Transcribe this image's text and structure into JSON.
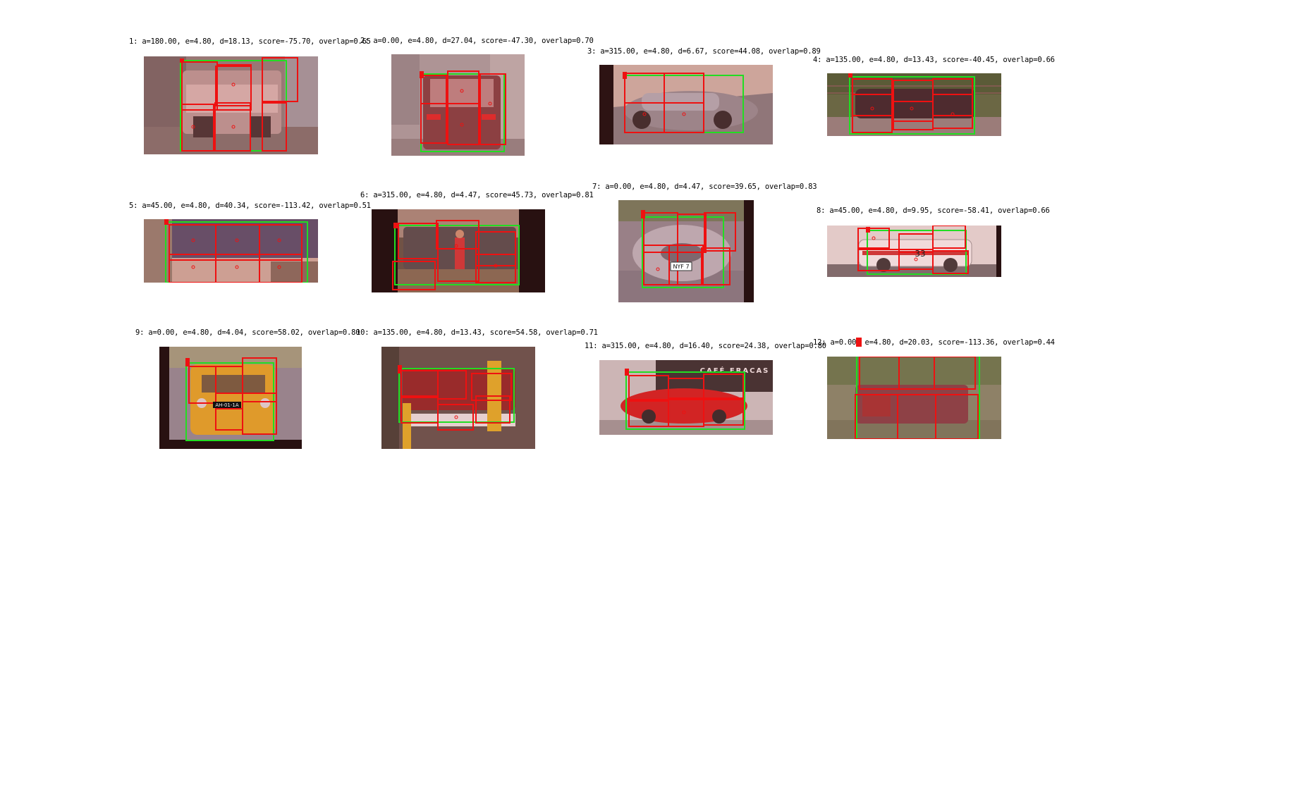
{
  "figure": {
    "background": "#ffffff",
    "colors": {
      "ground_truth_box": "#22dd22",
      "part_box": "#ee1111",
      "tint": "#e06060"
    },
    "panels": [
      {
        "id": 1,
        "caption": "1: a=180.00, e=4.80, d=18.13, score=-75.70, overlap=0.65",
        "scene": "car rear view at bus stop"
      },
      {
        "id": 2,
        "caption": "2: a=0.00, e=4.80, d=27.04, score=-47.30, overlap=0.70",
        "scene": "car rear view on street"
      },
      {
        "id": 3,
        "caption": "3: a=315.00, e=4.80, d=6.67, score=44.08, overlap=0.89",
        "scene": "silver sedan side-front view"
      },
      {
        "id": 4,
        "caption": "4: a=135.00, e=4.80, d=13.43, score=-40.45, overlap=0.66",
        "scene": "dark car on road with fence"
      },
      {
        "id": 5,
        "caption": "5: a=45.00, e=4.80, d=40.34, score=-113.42, overlap=0.51",
        "scene": "blurry close-up"
      },
      {
        "id": 6,
        "caption": "6: a=315.00, e=4.80, d=4.47, score=45.73, overlap=0.81",
        "scene": "person standing next to SUV"
      },
      {
        "id": 7,
        "caption": "7: a=0.00, e=4.80, d=4.47, score=39.65, overlap=0.83",
        "scene": "silver sports car front",
        "plate": "NYF 7"
      },
      {
        "id": 8,
        "caption": "8: a=45.00, e=4.80, d=9.95, score=-58.41, overlap=0.66",
        "scene": "white race car side view",
        "number": "33"
      },
      {
        "id": 9,
        "caption": "9: a=0.00, e=4.80, d=4.04, score=58.02, overlap=0.80",
        "scene": "yellow rally car front",
        "plate": "AH-01-1A"
      },
      {
        "id": 10,
        "caption": "10: a=135.00, e=4.80, d=13.43, score=54.58, overlap=0.71",
        "scene": "car behind gate barrier"
      },
      {
        "id": 11,
        "caption": "11: a=315.00, e=4.80, d=16.40, score=24.38, overlap=0.80",
        "scene": "red car in front of cafe",
        "sign": "CAFÉ FRACAS"
      },
      {
        "id": 12,
        "caption": "12: a=0.00, e=4.80, d=20.03, score=-113.36, overlap=0.44",
        "scene": "pixelated car scene"
      }
    ]
  }
}
